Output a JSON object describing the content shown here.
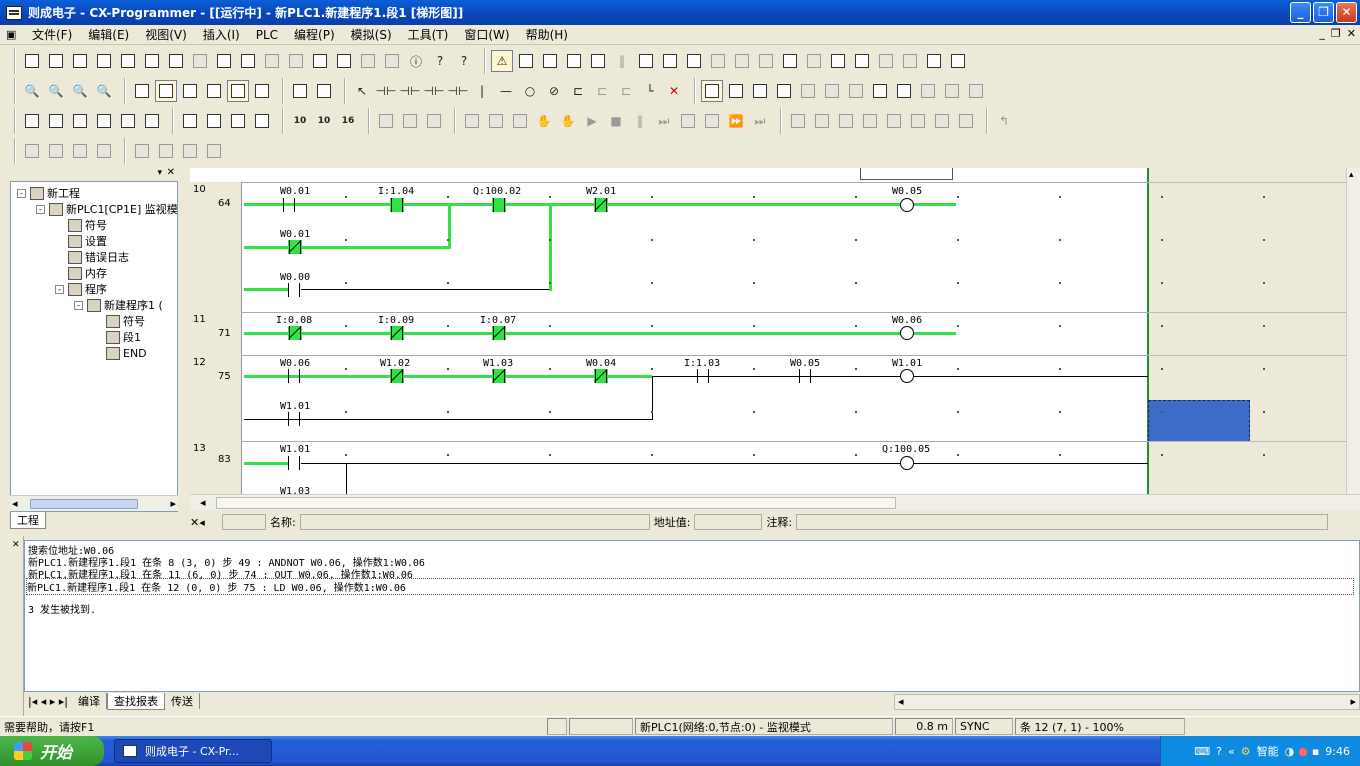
{
  "window": {
    "title": "则成电子 - CX-Programmer - [[运行中] - 新PLC1.新建程序1.段1 [梯形图]]"
  },
  "menu": [
    "文件(F)",
    "编辑(E)",
    "视图(V)",
    "插入(I)",
    "PLC",
    "编程(P)",
    "模拟(S)",
    "工具(T)",
    "窗口(W)",
    "帮助(H)"
  ],
  "tree": {
    "tab": "工程",
    "items": [
      {
        "label": "新工程",
        "level": 0,
        "icon": "project-icon",
        "pm": "-"
      },
      {
        "label": "新PLC1[CP1E] 监视模",
        "level": 1,
        "icon": "plc-icon",
        "pm": "-"
      },
      {
        "label": "符号",
        "level": 2,
        "icon": "symbols-icon",
        "pm": ""
      },
      {
        "label": "设置",
        "level": 2,
        "icon": "settings-icon",
        "pm": ""
      },
      {
        "label": "错误日志",
        "level": 2,
        "icon": "error-log-icon",
        "pm": ""
      },
      {
        "label": "内存",
        "level": 2,
        "icon": "memory-icon",
        "pm": ""
      },
      {
        "label": "程序",
        "level": 2,
        "icon": "programs-icon",
        "pm": "-"
      },
      {
        "label": "新建程序1 (",
        "level": 3,
        "icon": "program-icon",
        "pm": "-"
      },
      {
        "label": "符号",
        "level": 4,
        "icon": "symbols-icon",
        "pm": ""
      },
      {
        "label": "段1",
        "level": 4,
        "icon": "section-icon",
        "pm": ""
      },
      {
        "label": "END",
        "level": 4,
        "icon": "end-section-icon",
        "pm": ""
      }
    ]
  },
  "ladder": {
    "rungs": [
      {
        "num": "10",
        "step": "64"
      },
      {
        "num": "11",
        "step": "71"
      },
      {
        "num": "12",
        "step": "75"
      },
      {
        "num": "13",
        "step": "83"
      }
    ],
    "labels": {
      "r10a": "W0.01",
      "r10b": "I:1.04",
      "r10c": "Q:100.02",
      "r10d": "W2.01",
      "r10coil": "W0.05",
      "r10e": "W0.01",
      "r10f": "W0.00",
      "r11a": "I:0.08",
      "r11b": "I:0.09",
      "r11c": "I:0.07",
      "r11coil": "W0.06",
      "r12a": "W0.06",
      "r12b": "W1.02",
      "r12c": "W1.03",
      "r12d": "W0.04",
      "r12e": "I:1.03",
      "r12f": "W0.05",
      "r12coil": "W1.01",
      "r12g": "W1.01",
      "r13a": "W1.01",
      "r13coil": "Q:100.05",
      "r13b": "W1.03"
    }
  },
  "infobar": {
    "name_label": "名称:",
    "addr_label": "地址值:",
    "comment_label": "注释:"
  },
  "output": {
    "lines": [
      "搜索位地址:W0.06",
      "新PLC1.新建程序1.段1 在条 8 (3, 0) 步 49 : ANDNOT W0.06, 操作数1:W0.06",
      "新PLC1.新建程序1.段1 在条 11 (6, 0) 步 74 : OUT W0.06, 操作数1:W0.06",
      "新PLC1.新建程序1.段1 在条 12 (0, 0) 步 75 : LD W0.06, 操作数1:W0.06",
      "3 发生被找到."
    ],
    "tabs": [
      "编译",
      "查找报表",
      "传送"
    ],
    "active_tab": 1
  },
  "status": {
    "help": "需要帮助，请按F1",
    "plc": "新PLC1(网络:0,节点:0) - 监视模式",
    "time": "0.8 m",
    "sync": "SYNC",
    "pos": "条 12 (7, 1)  - 100%"
  },
  "taskbar": {
    "start": "开始",
    "task": "则成电子 - CX-Pr...",
    "clock": "9:46",
    "tray_text": "智能"
  },
  "colors": {
    "energized": "#33e048",
    "title": "#0a5fd8",
    "selection": "#3a6cc8"
  }
}
